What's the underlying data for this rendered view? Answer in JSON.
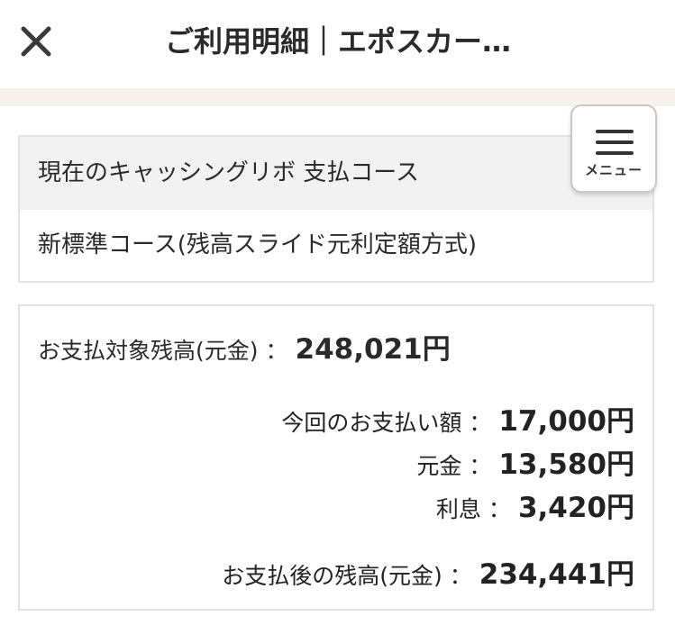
{
  "header": {
    "title": "ご利用明細｜エポスカー…",
    "close_icon": "close-icon"
  },
  "menu": {
    "label": "メニュー",
    "icon": "hamburger-icon"
  },
  "course": {
    "heading": "現在のキャッシングリボ 支払コース",
    "value": "新標準コース(残高スライド元利定額方式)"
  },
  "balance": {
    "target_label": "お支払対象残高(元金)",
    "target_amount": "248,021円",
    "payment_label": "今回のお支払い額",
    "payment_amount": "17,000円",
    "principal_label": "元金",
    "principal_amount": "13,580円",
    "interest_label": "利息",
    "interest_amount": "3,420円",
    "after_label": "お支払後の残高(元金)",
    "after_amount": "234,441円",
    "separator": "："
  },
  "colors": {
    "band": "#f7f2ec",
    "border": "#e2e2e2",
    "head_bg": "#f2f2f2"
  }
}
